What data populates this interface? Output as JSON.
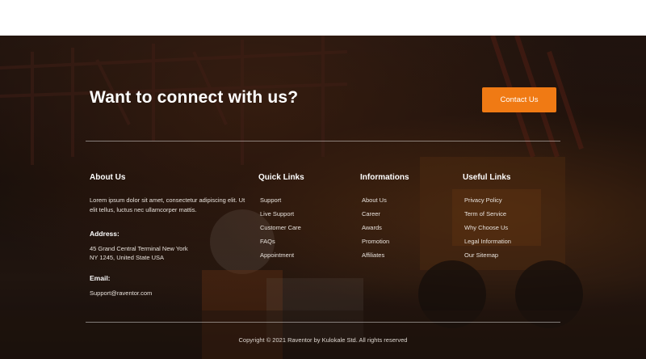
{
  "cta": {
    "title": "Want to connect with us?",
    "button_label": "Contact Us"
  },
  "colors": {
    "accent": "#f07a14",
    "text": "#ffffff"
  },
  "about": {
    "heading": "About Us",
    "description": "Lorem ipsum dolor sit amet, consectetur adipiscing elit. Ut elit tellus, luctus nec ullamcorper mattis.",
    "address_label": "Address:",
    "address_line1": "45 Grand Central Terminal New York",
    "address_line2": "NY 1245, United State USA",
    "email_label": "Email:",
    "email": "Support@raventor.com"
  },
  "quick_links": {
    "heading": "Quick Links",
    "items": [
      "Support",
      "Live Support",
      "Customer Care",
      "FAQs",
      "Appointment"
    ]
  },
  "informations": {
    "heading": "Informations",
    "items": [
      "About Us",
      "Career",
      "Awards",
      "Promotion",
      "Affiliates"
    ]
  },
  "useful_links": {
    "heading": "Useful Links",
    "items": [
      "Privacy Policy",
      "Term of Service",
      "Why Choose Us",
      "Legal Information",
      "Our Sitemap"
    ]
  },
  "copyright": "Copyright © 2021 Raventor by Kulokale Std. All rights reserved"
}
